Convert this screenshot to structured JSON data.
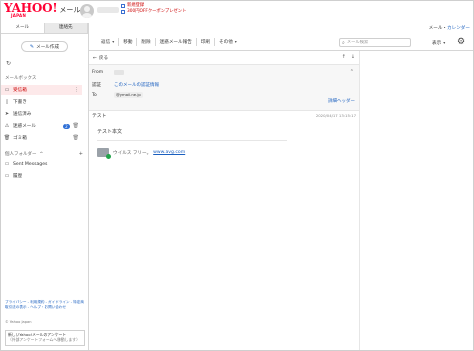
{
  "header": {
    "logo": "YAHOO!",
    "logo_sub": "JAPAN",
    "service": "メール",
    "promo_1": "新規登録",
    "promo_2": "300円OFFクーポンプレゼント",
    "right_prefix": "メール・",
    "right_link": "カレンダー"
  },
  "left_tabs": [
    "メール",
    "連絡先"
  ],
  "sidebar": {
    "compose": "メール作成",
    "mailbox_title": "メールボックス",
    "folders": [
      {
        "label": "受信箱",
        "icon": "inbox-icon",
        "selected": true
      },
      {
        "label": "下書き",
        "icon": "draft-icon"
      },
      {
        "label": "送信済み",
        "icon": "sent-icon"
      },
      {
        "label": "迷惑メール",
        "icon": "spam-icon",
        "count": "2"
      },
      {
        "label": "ゴミ箱",
        "icon": "trash-icon"
      }
    ],
    "personal_title": "個人フォルダー",
    "personal_folders": [
      "Sent Messages",
      "履歴"
    ],
    "links": "プライバシー - 利用規約 - ガイドライン - 特定商取引法の表示 - ヘルプ・お問い合わせ",
    "copyright": "© Yahoo Japan",
    "survey_title": "新しいYahoo!メールのアンケート",
    "survey_sub": "（外部アンケートフォームへ移動します）"
  },
  "toolbar": {
    "reply": "返信",
    "move": "移動",
    "delete": "削除",
    "spam": "迷惑メール報告",
    "print": "印刷",
    "other": "その他",
    "search_placeholder": "メール検索",
    "display": "表示"
  },
  "message": {
    "back": "戻る",
    "from_label": "From",
    "auth_label": "認証",
    "auth_link": "このメールの認証情報",
    "to_label": "To",
    "to_value": "@ymail.ne.jp",
    "detail": "詳細ヘッダー",
    "subject": "テスト",
    "date": "2020/04/17 13:15:17",
    "body": "テスト本文",
    "virus_text": "ウイルス フリー。",
    "virus_link": "www.avg.com"
  },
  "colors": {
    "brand": "#ff0033",
    "link": "#1a5fbf",
    "selected_bg": "#fde9ea"
  }
}
